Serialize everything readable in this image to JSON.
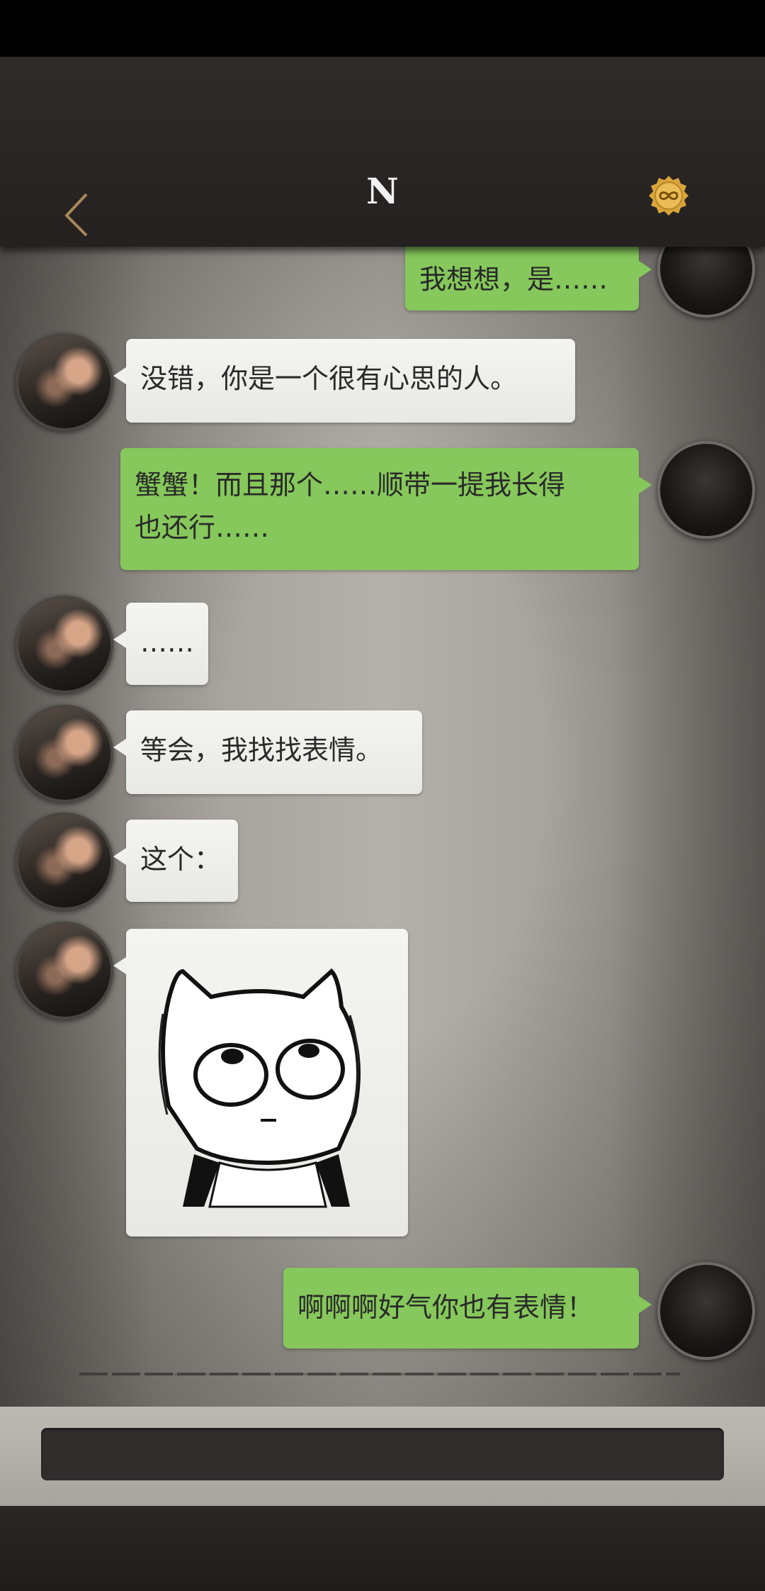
{
  "header": {
    "title": "N",
    "back_icon": "chevron-left-icon",
    "coin_icon": "infinity-coin-icon"
  },
  "colors": {
    "my_bubble": "#86c85b",
    "their_bubble": "#f0f0ed",
    "header_bg": "#2a2725"
  },
  "messages": [
    {
      "from": "me",
      "text": "我想想，是……"
    },
    {
      "from": "other",
      "text": "没错，你是一个很有心思的人。"
    },
    {
      "from": "me",
      "line1": "蟹蟹！而且那个……顺带一提我长得",
      "line2": "也还行……"
    },
    {
      "from": "other",
      "text": "……"
    },
    {
      "from": "other",
      "text": "等会，我找找表情。"
    },
    {
      "from": "other",
      "text": "这个："
    },
    {
      "from": "other",
      "sticker": "cat-rolling-eyes-sticker"
    },
    {
      "from": "me",
      "text": "啊啊啊好气你也有表情！"
    }
  ]
}
